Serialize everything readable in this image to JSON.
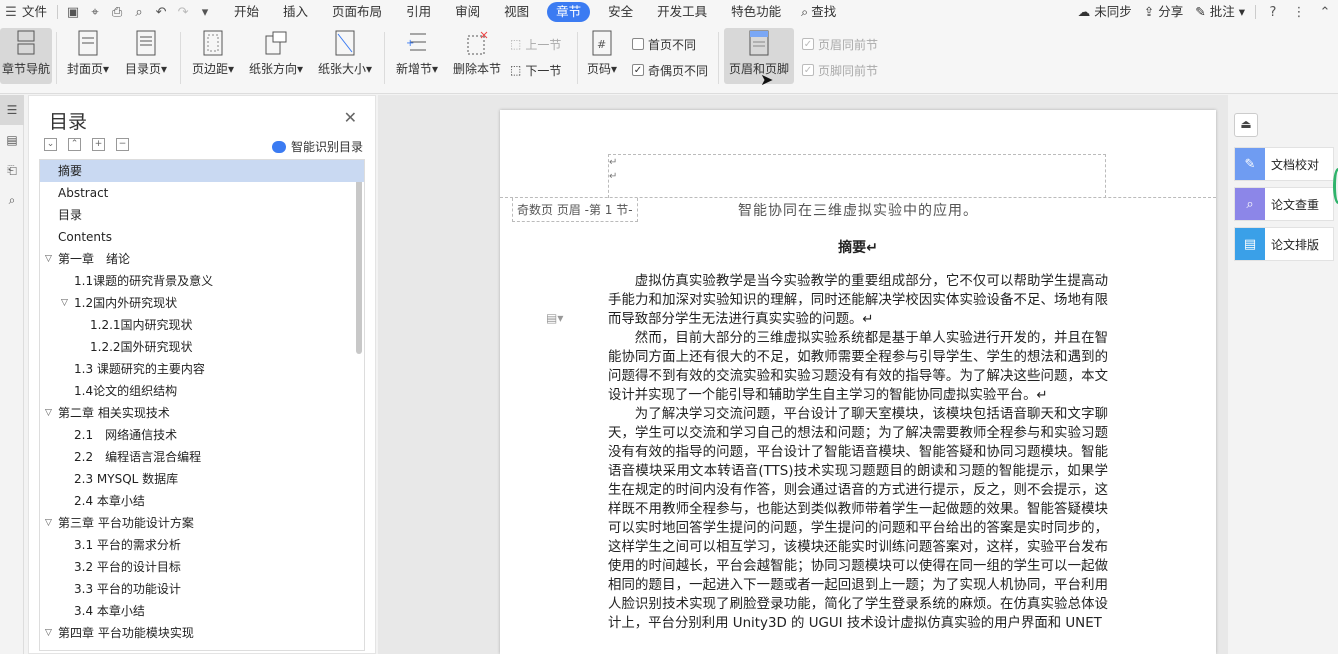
{
  "menubar": {
    "file": "文件",
    "tabs": [
      "开始",
      "插入",
      "页面布局",
      "引用",
      "审阅",
      "视图",
      "章节",
      "安全",
      "开发工具",
      "特色功能"
    ],
    "active_tab": "章节",
    "search": "查找",
    "sync": "未同步",
    "share": "分享",
    "comment": "批注"
  },
  "ribbon": {
    "nav": "章节导航",
    "cover": "封面页",
    "toc_page": "目录页",
    "margin": "页边距",
    "orientation": "纸张方向",
    "size": "纸张大小",
    "new_section": "新增节",
    "delete_section": "删除本节",
    "prev_section": "上一节",
    "next_section": "下一节",
    "page_number": "页码",
    "first_diff": "首页不同",
    "odd_even_diff": "奇偶页不同",
    "header_footer": "页眉和页脚",
    "header_same": "页眉同前节",
    "footer_same": "页脚同前节"
  },
  "toc": {
    "title": "目录",
    "smart": "智能识别目录",
    "items": [
      {
        "label": "摘要",
        "level": 0
      },
      {
        "label": "Abstract",
        "level": 0
      },
      {
        "label": "目录",
        "level": 0
      },
      {
        "label": "Contents",
        "level": 0
      },
      {
        "label": "第一章　绪论",
        "level": 0
      },
      {
        "label": "1.1课题的研究背景及意义",
        "level": 1
      },
      {
        "label": "1.2国内外研究现状",
        "level": 1
      },
      {
        "label": "1.2.1国内研究现状",
        "level": 2
      },
      {
        "label": "1.2.2国外研究现状",
        "level": 2
      },
      {
        "label": "1.3 课题研究的主要内容",
        "level": 1
      },
      {
        "label": "1.4论文的组织结构",
        "level": 1
      },
      {
        "label": "第二章 相关实现技术",
        "level": 0
      },
      {
        "label": "2.1　网络通信技术",
        "level": 1
      },
      {
        "label": "2.2　编程语言混合编程",
        "level": 1
      },
      {
        "label": "2.3 MYSQL 数据库",
        "level": 1
      },
      {
        "label": "2.4 本章小结",
        "level": 1
      },
      {
        "label": "第三章 平台功能设计方案",
        "level": 0
      },
      {
        "label": "3.1 平台的需求分析",
        "level": 1
      },
      {
        "label": "3.2 平台的设计目标",
        "level": 1
      },
      {
        "label": "3.3 平台的功能设计",
        "level": 1
      },
      {
        "label": "3.4 本章小结",
        "level": 1
      },
      {
        "label": "第四章 平台功能模块实现",
        "level": 0
      }
    ]
  },
  "doc": {
    "header_tag": "奇数页 页眉 -第 1 节-",
    "header_title": "智能协同在三维虚拟实验中的应用。",
    "heading": "摘要↵",
    "paragraphs": [
      "虚拟仿真实验教学是当今实验教学的重要组成部分，它不仅可以帮助学生提高动手能力和加深对实验知识的理解，同时还能解决学校因实体实验设备不足、场地有限而导致部分学生无法进行真实实验的问题。↵",
      "然而，目前大部分的三维虚拟实验系统都是基于单人实验进行开发的，并且在智能协同方面上还有很大的不足，如教师需要全程参与引导学生、学生的想法和遇到的问题得不到有效的交流实验和实验习题没有有效的指导等。为了解决这些问题，本文设计并实现了一个能引导和辅助学生自主学习的智能协同虚拟实验平台。↵",
      "为了解决学习交流问题，平台设计了聊天室模块，该模块包括语音聊天和文字聊天，学生可以交流和学习自己的想法和问题；为了解决需要教师全程参与和实验习题没有有效的指导的问题，平台设计了智能语音模块、智能答疑和协同习题模块。智能语音模块采用文本转语音(TTS)技术实现习题题目的朗读和习题的智能提示，如果学生在规定的时间内没有作答，则会通过语音的方式进行提示，反之，则不会提示，这样既不用教师全程参与，也能达到类似教师带着学生一起做题的效果。智能答疑模块可以实时地回答学生提问的问题，学生提问的问题和平台给出的答案是实时同步的，这样学生之间可以相互学习，该模块还能实时训练问题答案对，这样，实验平台发布使用的时间越长，平台会越智能；协同习题模块可以使得在同一组的学生可以一起做相同的题目，一起进入下一题或者一起回退到上一题；为了实现人机协同，平台利用人脸识别技术实现了刷脸登录功能，简化了学生登录系统的麻烦。在仿真实验总体设计上，平台分别利用 Unity3D 的 UGUI 技术设计虚拟仿真实验的用户界面和 UNET"
    ]
  },
  "right_panel": {
    "proofread": "文档校对",
    "dupcheck": "论文查重",
    "layout": "论文排版"
  },
  "colors": {
    "accent": "#3b7bf2",
    "proofread": "#6f9cf2",
    "dupcheck": "#8c86e8",
    "layout": "#3aa0e8"
  }
}
